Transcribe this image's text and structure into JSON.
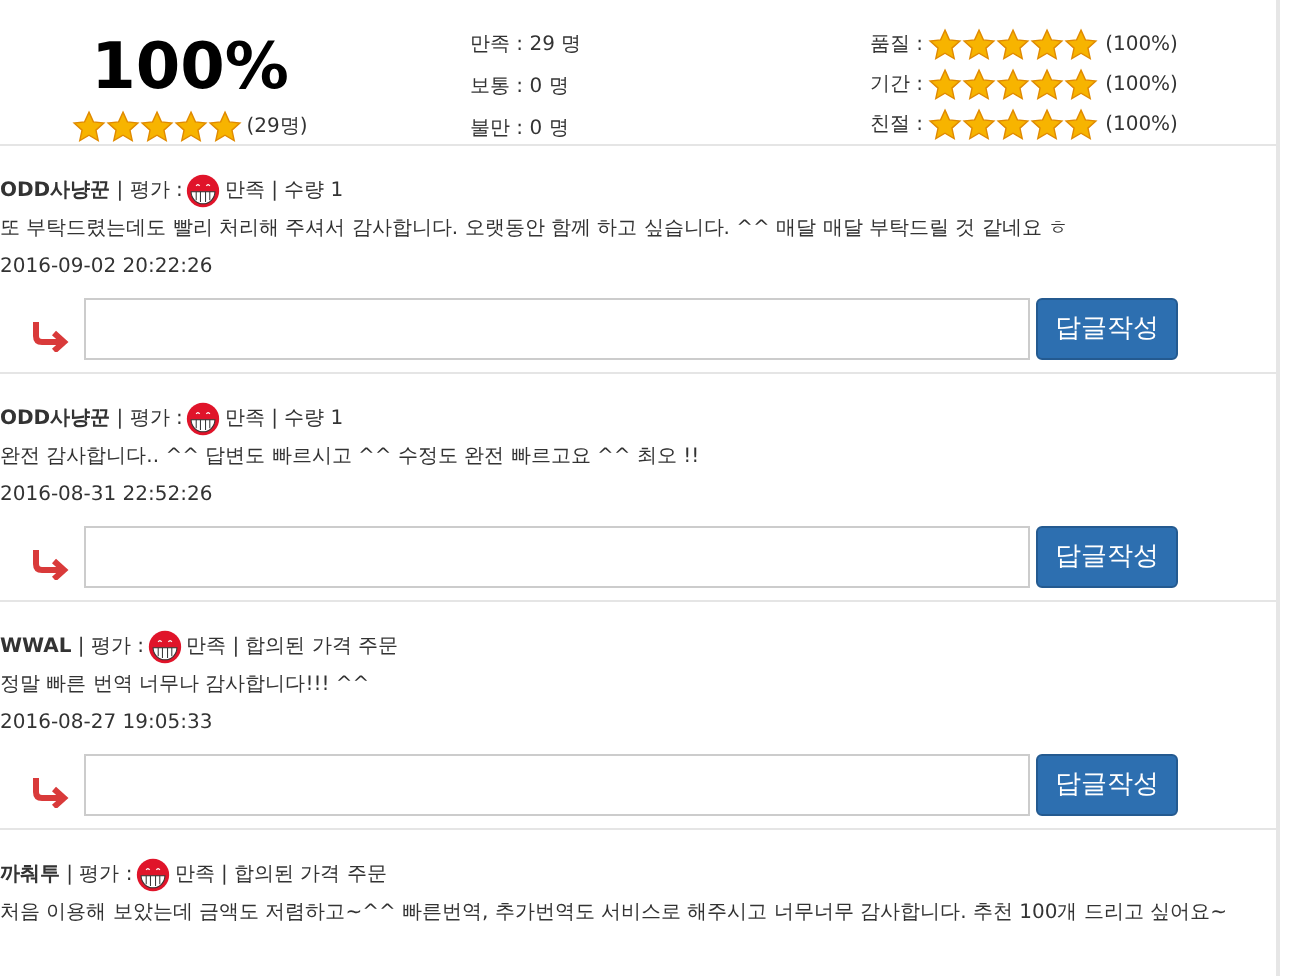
{
  "summary": {
    "percent": "100%",
    "stars": 5,
    "count": "(29명)",
    "counts": [
      {
        "label": "만족 : 29 명"
      },
      {
        "label": "보통 : 0 명"
      },
      {
        "label": "불만 : 0 명"
      }
    ],
    "categories": [
      {
        "label": "품질 :",
        "stars": 5,
        "percent": "(100%)"
      },
      {
        "label": "기간 :",
        "stars": 5,
        "percent": "(100%)"
      },
      {
        "label": "친절 :",
        "stars": 5,
        "percent": "(100%)"
      }
    ]
  },
  "reviews": [
    {
      "header": "**ODD사냥꾼** | 평가 :",
      "rating": "만족 | 수량 1",
      "comment": "또 부탁드렸는데도 빨리 처리해 주셔서 감사합니다. 오랫동안 함께 하고 싶습니다. ^^ 매달 매달 부탁드릴 것 같네요 ㅎ",
      "date": "2016-09-02 20:22:26",
      "reply_button": "답글작성"
    },
    {
      "header": "**ODD사냥꾼** | 평가 :",
      "rating": "만족 | 수량 1",
      "comment": "완전 감사합니다.. ^^ 답변도 빠르시고 ^^ 수정도 완전 빠르고요 ^^ 최오 !!",
      "date": "2016-08-31 22:52:26",
      "reply_button": "답글작성"
    },
    {
      "header": "**WWAL** | 평가 :",
      "rating": "만족 | 합의된 가격 주문",
      "comment": "정말 빠른 번역 너무나 감사합니다!!! ^^",
      "date": "2016-08-27 19:05:33",
      "reply_button": "답글작성"
    },
    {
      "header": "**까춰투** | 평가 :",
      "rating": "만족 | 합의된 가격 주문",
      "comment": "처음 이용해 보았는데 금액도 저렴하고~^^ 빠른번역, 추가번역도 서비스로 해주시고 너무너무 감사합니다. 추천 100개 드리고 싶어요~"
    }
  ]
}
